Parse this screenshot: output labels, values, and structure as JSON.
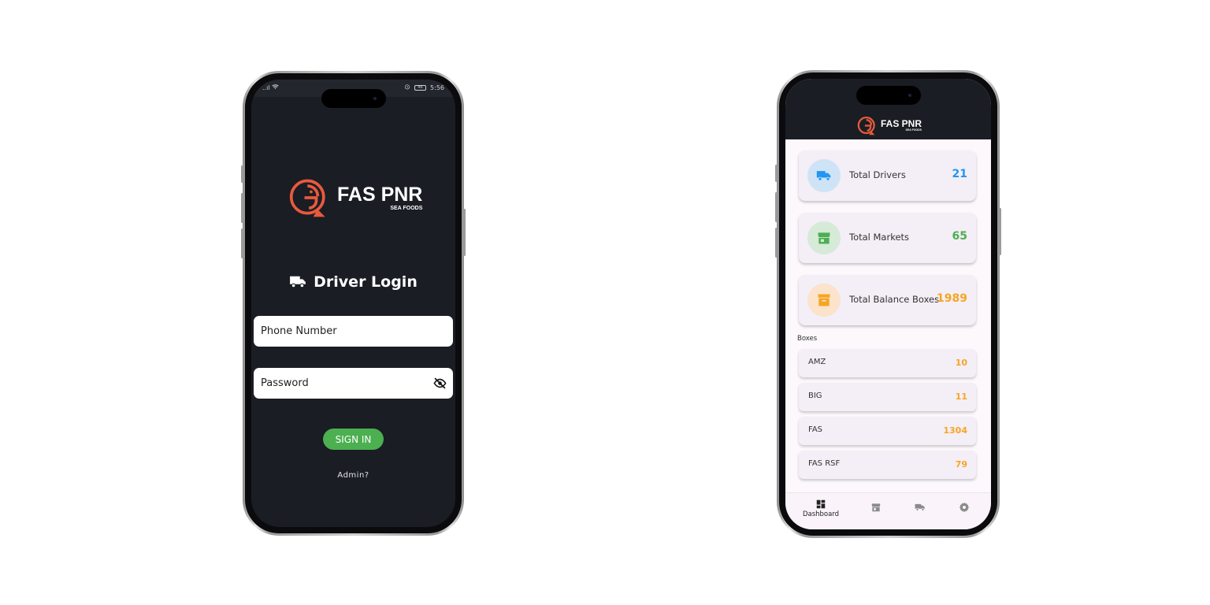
{
  "brand": {
    "name": "FAS PNR",
    "subtitle": "SEA FOODS",
    "accent_color": "#e85a3c"
  },
  "login_screen": {
    "status_bar": {
      "left_icons": [
        "signal-icon",
        "wifi-icon"
      ],
      "left_text": "..ıl",
      "alarm_icon": "alarm-icon",
      "battery_level": "46",
      "time": "5:56"
    },
    "title": "Driver Login",
    "title_icon": "truck-icon",
    "phone_placeholder": "Phone Number",
    "password_placeholder": "Password",
    "password_toggle_icon": "eye-off-icon",
    "sign_in_label": "SIGN IN",
    "admin_link_label": "Admin?",
    "colors": {
      "background": "#1a1d24",
      "sign_in_button": "#4caf50"
    }
  },
  "dashboard_screen": {
    "stats": [
      {
        "label": "Total Drivers",
        "value": "21",
        "icon": "truck-icon",
        "value_color": "#2196f3",
        "icon_bg": "#cfe3f7"
      },
      {
        "label": "Total Markets",
        "value": "65",
        "icon": "store-icon",
        "value_color": "#4caf50",
        "icon_bg": "#d6ead8"
      },
      {
        "label": "Total Balance Boxes",
        "value": "1989",
        "icon": "archive-box-icon",
        "value_color": "#f5a623",
        "icon_bg": "#fbe3cc"
      }
    ],
    "boxes_section_label": "Boxes",
    "boxes": [
      {
        "name": "AMZ",
        "count": "10"
      },
      {
        "name": "BIG",
        "count": "11"
      },
      {
        "name": "FAS",
        "count": "1304"
      },
      {
        "name": "FAS RSF",
        "count": "79"
      }
    ],
    "bottom_nav": [
      {
        "icon": "dashboard-icon",
        "label": "Dashboard",
        "active": true
      },
      {
        "icon": "store-icon",
        "label": "",
        "active": false
      },
      {
        "icon": "truck-icon",
        "label": "",
        "active": false
      },
      {
        "icon": "gear-icon",
        "label": "",
        "active": false
      }
    ]
  }
}
